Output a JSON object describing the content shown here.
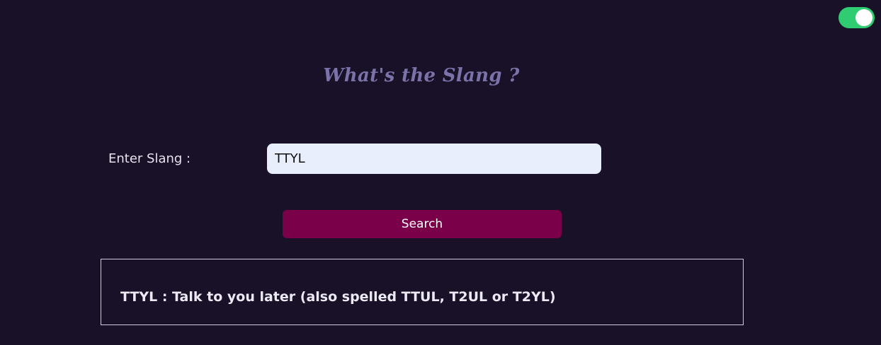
{
  "theme_toggle": {
    "state": "on",
    "colors": {
      "track": "#2fcc71",
      "knob": "#ffffff"
    }
  },
  "header": {
    "title": "What's the Slang ?"
  },
  "form": {
    "label": "Enter Slang :",
    "input_value": "TTYL",
    "search_label": "Search"
  },
  "result": {
    "text": "TTYL : Talk to you later (also spelled TTUL, T2UL or T2YL)"
  },
  "colors": {
    "background": "#181127",
    "title": "#7a72a8",
    "button": "#7a004a",
    "input_bg": "#e8eefc"
  }
}
